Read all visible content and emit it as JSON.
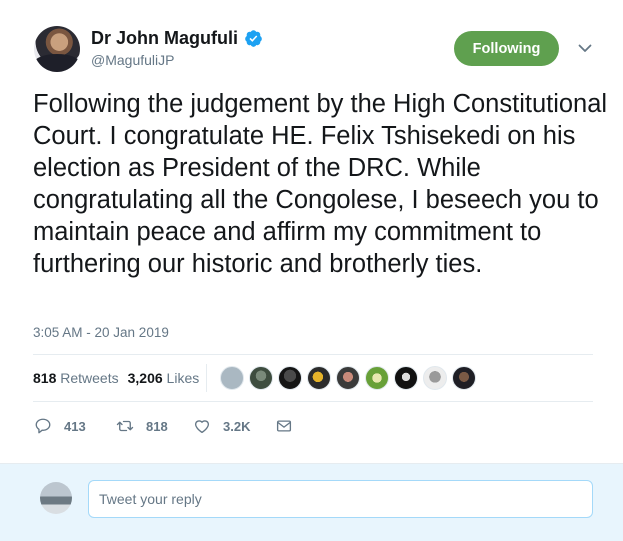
{
  "author": {
    "display_name": "Dr John Magufuli",
    "handle": "@MagufuliJP",
    "verified_icon": "verified-badge-icon"
  },
  "follow_button": {
    "label": "Following",
    "color": "#5fa04f"
  },
  "tweet": {
    "text": "Following the judgement by the High Constitutional Court. I congratulate HE. Felix Tshisekedi on his election as President of the DRC. While congratulating all the Congolese, I beseech you to maintain peace and affirm my commitment to furthering our historic and brotherly ties.",
    "timestamp": "3:05 AM - 20 Jan 2019"
  },
  "stats": {
    "retweets_count": "818",
    "retweets_label": "Retweets",
    "likes_count": "3,206",
    "likes_label": "Likes",
    "liker_avatars": 9
  },
  "actions": {
    "reply_count": "413",
    "retweet_count": "818",
    "like_count": "3.2K"
  },
  "reply": {
    "placeholder": "Tweet your reply"
  },
  "colors": {
    "accent": "#1da1f2",
    "text_primary": "#14171a",
    "text_secondary": "#657786",
    "reply_bg": "#e8f5fd"
  }
}
